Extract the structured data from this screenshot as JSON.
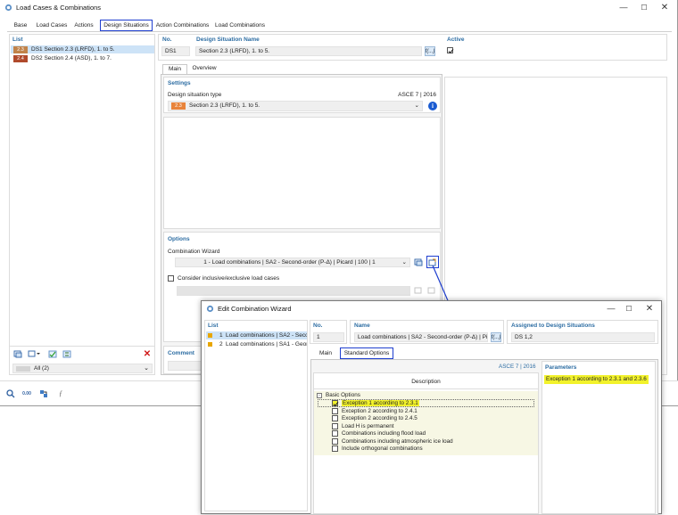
{
  "main_window": {
    "title": "Load Cases & Combinations",
    "tabs": [
      "Base",
      "Load Cases",
      "Actions",
      "Design Situations",
      "Action Combinations",
      "Load Combinations"
    ],
    "list_header": "List",
    "list_items": [
      {
        "badge": "2.3",
        "badge_color": "#c1834a",
        "label": "DS1  Section 2.3 (LRFD), 1. to 5."
      },
      {
        "badge": "2.4",
        "badge_color": "#b04a2c",
        "label": "DS2  Section 2.4 (ASD), 1. to 7."
      }
    ],
    "filter_value": "All (2)",
    "no_label": "No.",
    "no_value": "DS1",
    "name_label": "Design Situation Name",
    "name_value": "Section 2.3 (LRFD), 1. to 5.",
    "active_label": "Active",
    "inner_tabs": [
      "Main",
      "Overview"
    ],
    "settings_label": "Settings",
    "ds_type_label": "Design situation type",
    "ds_standard": "ASCE 7 | 2016",
    "ds_type_badge": "2.3",
    "ds_type_value": "Section 2.3 (LRFD), 1. to 5.",
    "options_label": "Options",
    "combo_wizard_label": "Combination Wizard",
    "combo_wizard_value": "1 - Load combinations | SA2 - Second-order (P-Δ) | Picard | 100 | 1",
    "consider_label": "Consider inclusive/exclusive load cases",
    "comment_label": "Comment"
  },
  "dialog": {
    "title": "Edit Combination Wizard",
    "list_header": "List",
    "list_items": [
      {
        "num": "1",
        "label": "Load combinations | SA2 - Secon",
        "color": "#e8a600"
      },
      {
        "num": "2",
        "label": "Load combinations | SA1 - Geom",
        "color": "#e8a600"
      }
    ],
    "no_label": "No.",
    "no_value": "1",
    "name_label": "Name",
    "name_value": "Load combinations | SA2 - Second-order (P-Δ) | Picar",
    "assigned_label": "Assigned to Design Situations",
    "assigned_value": "DS 1,2",
    "tabs": [
      "Main",
      "Standard Options"
    ],
    "standard": "ASCE 7 | 2016",
    "description_header": "Description",
    "parameters_header": "Parameters",
    "parameter_value": "Exception 1 according to 2.3.1 and 2.3.6",
    "group_label": "Basic Options",
    "options": [
      {
        "label": "Exception 1 according to 2.3.1",
        "checked": true
      },
      {
        "label": "Exception 2 according to 2.4.1",
        "checked": false
      },
      {
        "label": "Exception 2 according to 2.4.5",
        "checked": false
      },
      {
        "label": "Load H is permanent",
        "checked": false
      },
      {
        "label": "Combinations including flood load",
        "checked": false
      },
      {
        "label": "Combinations including atmospheric ice load",
        "checked": false
      },
      {
        "label": "Include orthogonal combinations",
        "checked": false
      }
    ],
    "highlight_color": "#f2f22b"
  }
}
